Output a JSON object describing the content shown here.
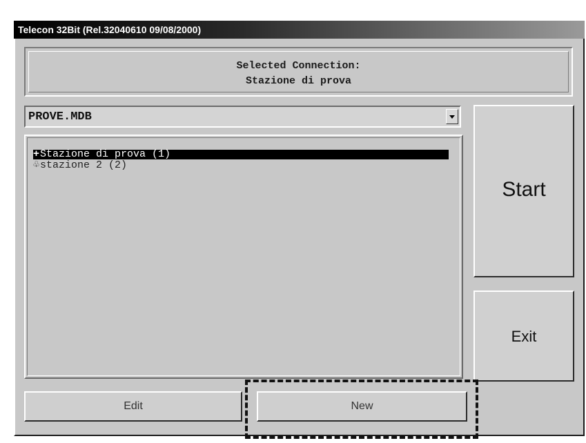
{
  "window": {
    "title": "Telecon 32Bit (Rel.32040610 09/08/2000)"
  },
  "connection": {
    "label": "Selected Connection:",
    "name": "Stazione di prova"
  },
  "database_select": {
    "value": "PROVE.MDB"
  },
  "tree": {
    "items": [
      {
        "glyph": "+",
        "label": "Stazione di prova (1)",
        "selected": true
      },
      {
        "glyph": "♧",
        "label": "stazione 2 (2)",
        "selected": false
      }
    ]
  },
  "buttons": {
    "start": "Start",
    "exit": "Exit",
    "edit": "Edit",
    "new": "New"
  }
}
